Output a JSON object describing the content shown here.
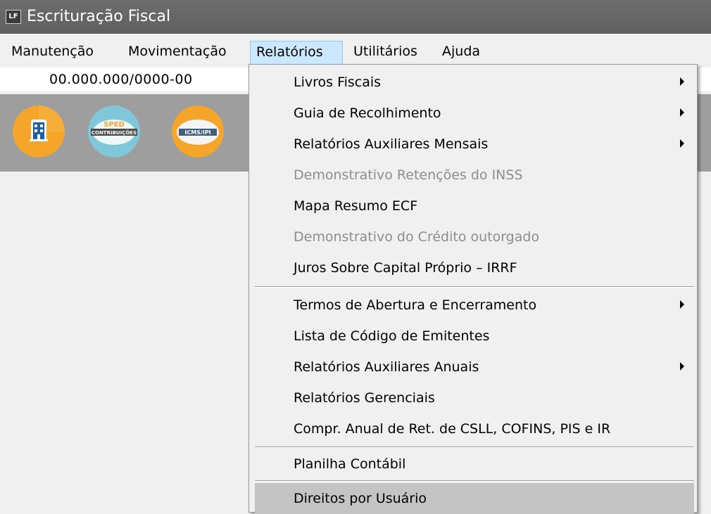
{
  "window": {
    "title": "Escrituração Fiscal",
    "icon_text": "LF",
    "icon_name": "app-lf-icon"
  },
  "menubar": {
    "items": [
      {
        "label": "Manutenção"
      },
      {
        "label": "Movimentação"
      },
      {
        "label": "Relatórios"
      },
      {
        "label": "Utilitários"
      },
      {
        "label": "Ajuda"
      }
    ],
    "active": "Relatórios"
  },
  "company": {
    "cnpj": "00.000.000/0000-00"
  },
  "toolbar": {
    "buttons": [
      {
        "icon": "building-icon"
      },
      {
        "icon": "sped-contribuicoes-icon",
        "top_text": "SPED",
        "band_text": "CONTRIBUIÇÕES"
      },
      {
        "icon": "icms-ipi-icon",
        "band_text": "ICMS/IPI"
      }
    ]
  },
  "relatorios_menu": {
    "items": [
      {
        "label": "Livros Fiscais",
        "submenu": true,
        "enabled": true
      },
      {
        "label": "Guia de Recolhimento",
        "submenu": true,
        "enabled": true
      },
      {
        "label": "Relatórios Auxiliares Mensais",
        "submenu": true,
        "enabled": true
      },
      {
        "label": "Demonstrativo Retenções do INSS",
        "submenu": false,
        "enabled": false
      },
      {
        "label": "Mapa Resumo ECF",
        "submenu": false,
        "enabled": true
      },
      {
        "label": "Demonstrativo do Crédito outorgado",
        "submenu": false,
        "enabled": false
      },
      {
        "label": "Juros Sobre Capital Próprio – IRRF",
        "submenu": false,
        "enabled": true
      },
      {
        "label": "Termos de Abertura e Encerramento",
        "submenu": true,
        "enabled": true
      },
      {
        "label": "Lista de Código de Emitentes",
        "submenu": false,
        "enabled": true
      },
      {
        "label": "Relatórios Auxiliares Anuais",
        "submenu": true,
        "enabled": true
      },
      {
        "label": "Relatórios Gerenciais",
        "submenu": false,
        "enabled": true
      },
      {
        "label": "Compr. Anual de Ret. de CSLL, COFINS,  PIS e IR",
        "submenu": false,
        "enabled": true
      },
      {
        "label": "Planilha Contábil",
        "submenu": false,
        "enabled": true
      },
      {
        "label": "Direitos por Usuário",
        "submenu": false,
        "enabled": true,
        "highlighted": true
      }
    ]
  },
  "colors": {
    "titlebar": "#666666",
    "toolbar": "#9e9e9e",
    "menu_active": "#cce8ff",
    "item_highlight": "#c4c4c4",
    "disabled_text": "#8d8d8d",
    "icon_orange": "#f4a52a",
    "icon_teal": "#7fc7d9"
  }
}
